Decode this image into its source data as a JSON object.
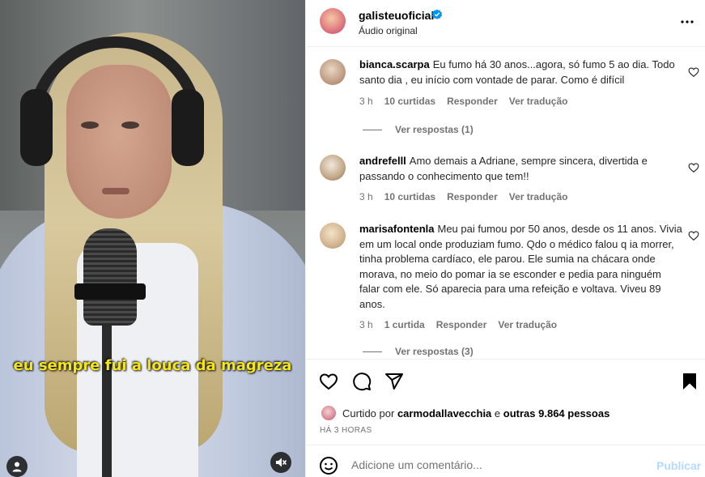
{
  "video": {
    "caption": "eu sempre fui a louca da magreza"
  },
  "header": {
    "username": "galisteuoficial",
    "audio": "Áudio original",
    "icons": {
      "verified": "verified-badge-icon",
      "more": "more-options-icon"
    }
  },
  "comments": [
    {
      "username": "bianca.scarpa",
      "text": "Eu fumo há 30 anos...agora, só fumo 5 ao dia. Todo santo dia , eu início com vontade de parar. Como é difícil",
      "time": "3 h",
      "likes": "10 curtidas",
      "reply": "Responder",
      "translate": "Ver tradução",
      "replies": "Ver respostas (1)"
    },
    {
      "username": "andrefelll",
      "text": "Amo demais a Adriane, sempre sincera, divertida e passando o conhecimento que tem!!",
      "time": "3 h",
      "likes": "10 curtidas",
      "reply": "Responder",
      "translate": "Ver tradução"
    },
    {
      "username": "marisafontenla",
      "text": "Meu pai fumou por 50 anos, desde os 11 anos. Vivia em um local onde produziam fumo. Qdo o médico falou q ia morrer, tinha problema cardíaco, ele parou. Ele sumia na chácara onde morava, no meio do pomar ia se esconder e pedia para ninguém falar com ele. Só aparecia para uma refeição e voltava. Viveu 89 anos.",
      "time": "3 h",
      "likes": "1 curtida",
      "reply": "Responder",
      "translate": "Ver tradução",
      "replies": "Ver respostas (3)"
    }
  ],
  "actions": {
    "liked_prefix": "Curtido por",
    "liked_user": "carmodallavecchia",
    "liked_middle": "e",
    "liked_others": "outras 9.864 pessoas",
    "timestamp": "HÁ 3 HORAS"
  },
  "add_comment": {
    "placeholder": "Adicione um comentário...",
    "publish": "Publicar"
  },
  "colors": {
    "caption": "#f5e51a",
    "publish_disabled": "#b3dbff",
    "verified": "#0095f6",
    "secondary_text": "#737373"
  }
}
